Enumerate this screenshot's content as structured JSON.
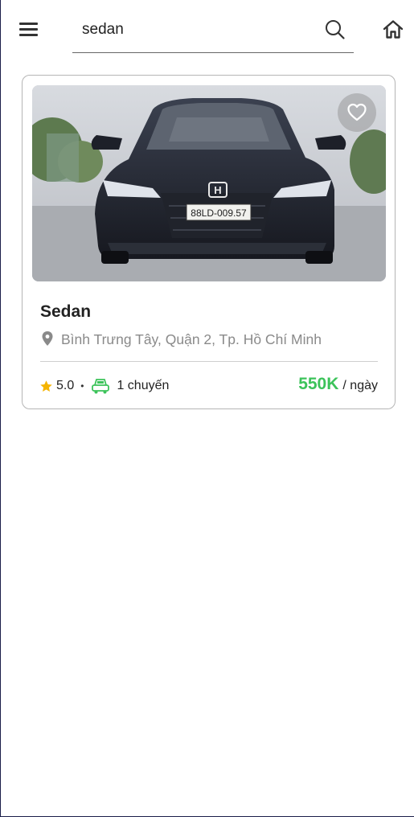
{
  "header": {
    "menu_icon": "hamburger-menu-icon",
    "search_value": "sedan",
    "search_icon": "magnifier-icon",
    "home_icon": "home-icon"
  },
  "listing": {
    "title": "Sedan",
    "location": "Bình Trưng Tây, Quận 2, Tp. Hồ Chí Minh",
    "rating": "5.0",
    "separator": "•",
    "trips": "1 chuyến",
    "price": "550K",
    "price_unit": "/ ngày",
    "license_plate": "88LD-009.57",
    "favorite_icon": "heart-outline-icon",
    "colors": {
      "price": "#3cc35a",
      "star": "#f5b400",
      "trip_icon": "#3cc35a"
    }
  }
}
